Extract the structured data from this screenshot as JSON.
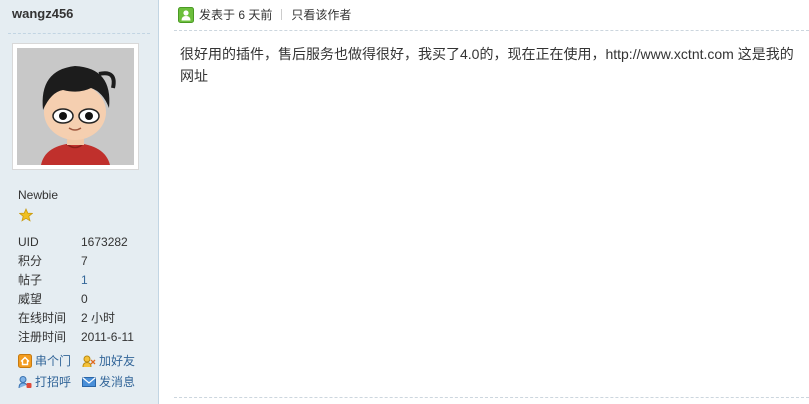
{
  "author": {
    "username": "wangz456",
    "group": "Newbie",
    "stats": [
      {
        "label": "UID",
        "value": "1673282",
        "link": false
      },
      {
        "label": "积分",
        "value": "7",
        "link": false
      },
      {
        "label": "帖子",
        "value": "1",
        "link": true
      },
      {
        "label": "威望",
        "value": "0",
        "link": false
      },
      {
        "label": "在线时间",
        "value": "2 小时",
        "link": false
      },
      {
        "label": "注册时间",
        "value": "2011-6-11",
        "link": false
      }
    ],
    "actions": {
      "visit": "串个门",
      "add_friend": "加好友",
      "poke": "打招呼",
      "message": "发消息"
    }
  },
  "post": {
    "posted_label": "发表于 6 天前",
    "author_only": "只看该作者",
    "content": "很好用的插件，售后服务也做得很好，我买了4.0的，现在正在使用，http://www.xctnt.com 这是我的网址"
  },
  "colors": {
    "sidebar_bg": "#e5edf2",
    "link": "#336699",
    "star": "#f0c020"
  },
  "icons": [
    "post-status-icon",
    "level-star-icon",
    "home-icon",
    "friend-icon",
    "poke-icon",
    "mail-icon"
  ]
}
